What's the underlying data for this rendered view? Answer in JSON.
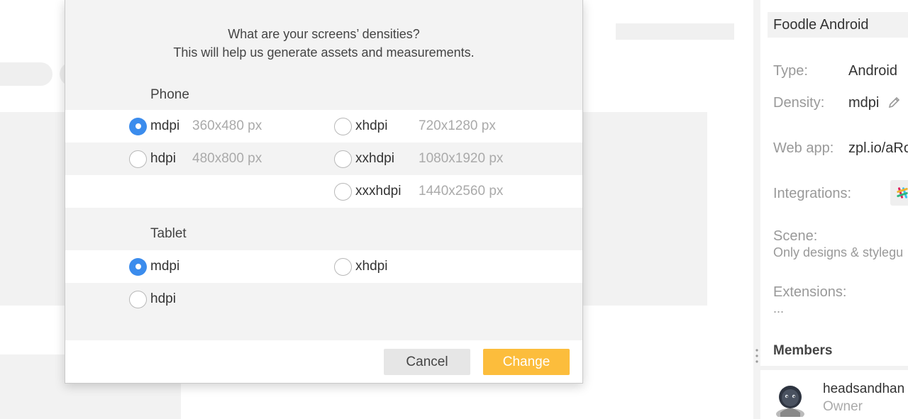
{
  "modal": {
    "title_line1": "What are your screens’ densities?",
    "title_line2": "This will help us generate assets and measurements.",
    "phone": {
      "label": "Phone",
      "options": [
        {
          "name": "mdpi",
          "size": "360x480 px",
          "checked": true
        },
        {
          "name": "xhdpi",
          "size": "720x1280 px",
          "checked": false
        },
        {
          "name": "hdpi",
          "size": "480x800 px",
          "checked": false
        },
        {
          "name": "xxhdpi",
          "size": "1080x1920 px",
          "checked": false
        },
        {
          "name": "xxxhdpi",
          "size": "1440x2560 px",
          "checked": false
        }
      ]
    },
    "tablet": {
      "label": "Tablet",
      "options": [
        {
          "name": "mdpi",
          "checked": true
        },
        {
          "name": "xhdpi",
          "checked": false
        },
        {
          "name": "hdpi",
          "checked": false
        }
      ]
    },
    "cancel_label": "Cancel",
    "change_label": "Change"
  },
  "sidebar": {
    "project_name": "Foodle Android",
    "type_label": "Type:",
    "type_value": "Android",
    "density_label": "Density:",
    "density_value": "mdpi",
    "webapp_label": "Web app:",
    "webapp_value": "zpl.io/aRo",
    "integrations_label": "Integrations:",
    "scene_label": "Scene:",
    "scene_value": "Only designs & stylegu",
    "extensions_label": "Extensions:",
    "extensions_value": "...",
    "members_title": "Members",
    "member_name": "headsandhan",
    "member_role": "Owner"
  },
  "colors": {
    "accent_blue": "#3b8ced",
    "change_button": "#fcbd3c"
  }
}
